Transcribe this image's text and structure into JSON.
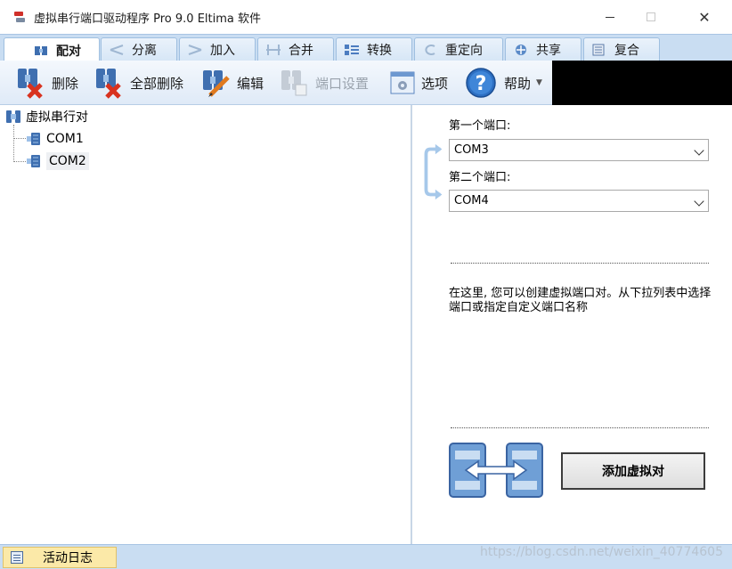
{
  "window": {
    "title": "虚拟串行端口驱动程序 Pro 9.0 Eltima 软件",
    "app_icon": "serial-cable-icon"
  },
  "tabs": [
    {
      "label": "配对",
      "icon": "pair-icon",
      "active": true
    },
    {
      "label": "分离",
      "icon": "split-icon",
      "active": false
    },
    {
      "label": "加入",
      "icon": "join-icon",
      "active": false
    },
    {
      "label": "合并",
      "icon": "merge-icon",
      "active": false
    },
    {
      "label": "转换",
      "icon": "convert-icon",
      "active": false
    },
    {
      "label": "重定向",
      "icon": "redirect-icon",
      "active": false
    },
    {
      "label": "共享",
      "icon": "share-icon",
      "active": false
    },
    {
      "label": "复合",
      "icon": "composite-icon",
      "active": false
    }
  ],
  "toolbar": {
    "delete": "删除",
    "delete_all": "全部删除",
    "edit": "编辑",
    "port_settings": "端口设置",
    "options": "选项",
    "help": "帮助"
  },
  "tree": {
    "root": "虚拟串行对",
    "items": [
      "COM1",
      "COM2"
    ]
  },
  "pairing": {
    "first_port_label": "第一个端口:",
    "first_port_value": "COM3",
    "second_port_label": "第二个端口:",
    "second_port_value": "COM4",
    "description": "在这里, 您可以创建虚拟端口对。从下拉列表中选择端口或指定自定义端口名称",
    "add_button": "添加虚拟对"
  },
  "status": {
    "activity_log": "活动日志"
  },
  "watermark": "https://blog.csdn.net/weixin_40774605",
  "colors": {
    "tab_strip": "#c9ddf2",
    "status_tab": "#fbe9a8",
    "delete_red": "#d8321f",
    "help_blue": "#2d6fc2"
  }
}
